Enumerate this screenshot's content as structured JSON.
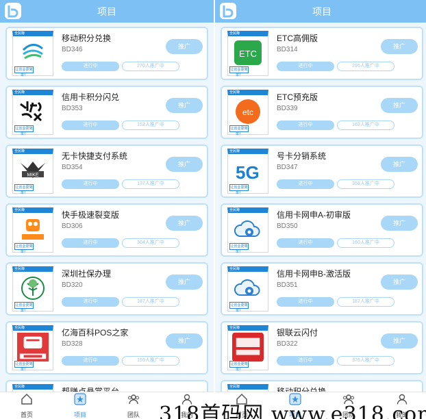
{
  "colors": {
    "header": "#7cc0f4",
    "accent": "#a9d7f7",
    "border": "#bfe0f8"
  },
  "header": {
    "title": "项目"
  },
  "left_list": [
    {
      "name": "移动积分兑换",
      "code": "BD346",
      "status": "进行中",
      "count": "270人推广中",
      "button": "推广",
      "icon": "mobile-logo-icon"
    },
    {
      "name": "信用卡积分闪兑",
      "code": "BD353",
      "status": "进行中",
      "count": "152人推广中",
      "button": "推广",
      "icon": "calligraphy-icon"
    },
    {
      "name": "无卡快捷支付系统",
      "code": "BD354",
      "status": "进行中",
      "count": "137人推广中",
      "button": "推广",
      "icon": "mike-logo-icon"
    },
    {
      "name": "快手极速裂变版",
      "code": "BD306",
      "status": "进行中",
      "count": "304人推广中",
      "button": "推广",
      "icon": "kuaishou-icon"
    },
    {
      "name": "深圳社保办理",
      "code": "BD320",
      "status": "进行中",
      "count": "187人推广中",
      "button": "推广",
      "icon": "social-security-icon"
    },
    {
      "name": "亿海百科POS之家",
      "code": "BD328",
      "status": "进行中",
      "count": "159人推广中",
      "button": "推广",
      "icon": "pos-card-icon"
    },
    {
      "name": "帮赚点悬赏平台",
      "code": "",
      "status": "",
      "count": "",
      "button": "",
      "icon": "reward-icon"
    }
  ],
  "right_list": [
    {
      "name": "ETC高佣版",
      "code": "BD314",
      "status": "进行中",
      "count": "295人推广中",
      "button": "推广",
      "icon": "etc-green-icon"
    },
    {
      "name": "ETC预充版",
      "code": "BD339",
      "status": "进行中",
      "count": "162人推广中",
      "button": "推广",
      "icon": "etc-orange-icon"
    },
    {
      "name": "号卡分销系统",
      "code": "BD347",
      "status": "进行中",
      "count": "358人推广中",
      "button": "推广",
      "icon": "5g-icon"
    },
    {
      "name": "信用卡网申A-初审版",
      "code": "BD350",
      "status": "进行中",
      "count": "160人推广中",
      "button": "推广",
      "icon": "cloud-gear-icon"
    },
    {
      "name": "信用卡网申B-激活版",
      "code": "BD351",
      "status": "进行中",
      "count": "187人推广中",
      "button": "推广",
      "icon": "cloud-gear-icon"
    },
    {
      "name": "银联云闪付",
      "code": "BD322",
      "status": "进行中",
      "count": "376人推广中",
      "button": "推广",
      "icon": "unionpay-icon"
    },
    {
      "name": "移动积分兑换",
      "code": "",
      "status": "",
      "count": "",
      "button": "",
      "icon": "mobile-logo-icon"
    }
  ],
  "thumb": {
    "brand": "全民赚",
    "tag": "让创业更简单！"
  },
  "tabbar_left": [
    {
      "label": "首页",
      "icon": "home-icon"
    },
    {
      "label": "项目",
      "icon": "star-icon",
      "active": true
    },
    {
      "label": "团队",
      "icon": "team-icon"
    },
    {
      "label": "我的",
      "icon": "profile-icon"
    }
  ],
  "tabbar_right": [
    {
      "label": "首页",
      "icon": "home-icon"
    },
    {
      "label": "项目",
      "icon": "star-icon",
      "active": true
    },
    {
      "label": "团队",
      "icon": "team-icon"
    },
    {
      "label": "我的",
      "icon": "profile-icon"
    }
  ],
  "watermark": "318首码网 www.e318.com"
}
